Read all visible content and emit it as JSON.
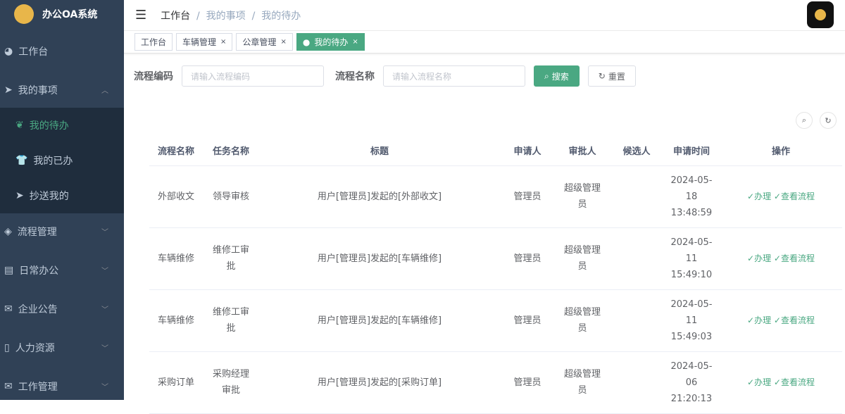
{
  "app": {
    "title": "办公OA系统"
  },
  "sidebar": {
    "items": [
      {
        "label": "工作台",
        "icon": "dashboard-icon"
      },
      {
        "label": "我的事项",
        "icon": "send-icon",
        "expanded": true
      },
      {
        "label": "我的待办",
        "icon": "leaf-icon",
        "sub": true,
        "active": true
      },
      {
        "label": "我的已办",
        "icon": "shirt-icon",
        "sub": true
      },
      {
        "label": "抄送我的",
        "icon": "send-icon",
        "sub": true
      },
      {
        "label": "流程管理",
        "icon": "cube-icon"
      },
      {
        "label": "日常办公",
        "icon": "doc-icon"
      },
      {
        "label": "企业公告",
        "icon": "mail-icon"
      },
      {
        "label": "人力资源",
        "icon": "book-icon"
      },
      {
        "label": "工作管理",
        "icon": "mail-icon"
      }
    ]
  },
  "breadcrumb": [
    "工作台",
    "我的事项",
    "我的待办"
  ],
  "tabs": [
    {
      "label": "工作台"
    },
    {
      "label": "车辆管理"
    },
    {
      "label": "公章管理"
    },
    {
      "label": "我的待办",
      "active": true
    }
  ],
  "search": {
    "code_label": "流程编码",
    "code_placeholder": "请输入流程编码",
    "name_label": "流程名称",
    "name_placeholder": "请输入流程名称",
    "search_btn": "搜索",
    "reset_btn": "重置"
  },
  "table": {
    "columns": [
      "流程名称",
      "任务名称",
      "标题",
      "申请人",
      "审批人",
      "候选人",
      "申请时间",
      "操作"
    ],
    "rows": [
      {
        "flow": "外部收文",
        "task": "领导审核",
        "title": "用户[管理员]发起的[外部收文]",
        "applicant": "管理员",
        "approver": "超级管理员",
        "candidate": "",
        "time": "2024-05-18 13:48:59"
      },
      {
        "flow": "车辆维修",
        "task": "维修工审批",
        "title": "用户[管理员]发起的[车辆维修]",
        "applicant": "管理员",
        "approver": "超级管理员",
        "candidate": "",
        "time": "2024-05-11 15:49:10"
      },
      {
        "flow": "车辆维修",
        "task": "维修工审批",
        "title": "用户[管理员]发起的[车辆维修]",
        "applicant": "管理员",
        "approver": "超级管理员",
        "candidate": "",
        "time": "2024-05-11 15:49:03"
      },
      {
        "flow": "采购订单",
        "task": "采购经理审批",
        "title": "用户[管理员]发起的[采购订单]",
        "applicant": "管理员",
        "approver": "超级管理员",
        "candidate": "",
        "time": "2024-05-06 21:20:13"
      }
    ],
    "actions": [
      "✓办理",
      "✓查看流程"
    ]
  },
  "colors": {
    "accent": "#4aa882",
    "sidebar": "#304156"
  }
}
